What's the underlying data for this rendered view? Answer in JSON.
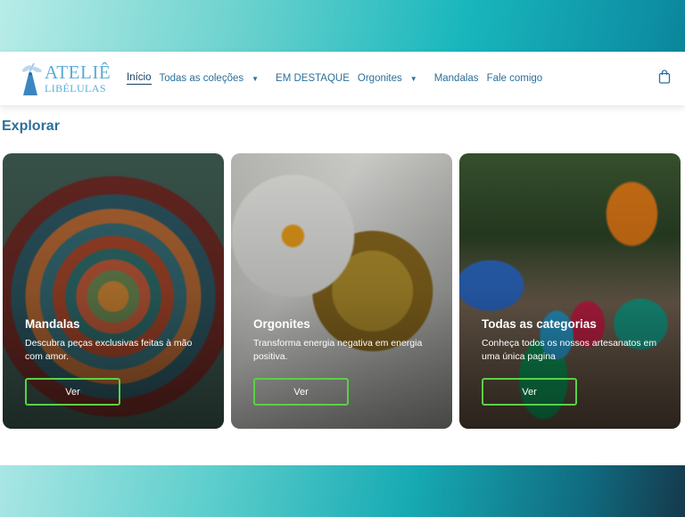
{
  "brand": {
    "logo_line1": "ATELIÊ",
    "logo_line2": "LIBÉLULAS",
    "accent_color": "#5aaed8"
  },
  "nav": {
    "items": [
      {
        "label": "Início",
        "active": true,
        "has_dropdown": false
      },
      {
        "label": "Todas as coleções",
        "active": false,
        "has_dropdown": true
      },
      {
        "label": "EM DESTAQUE",
        "active": false,
        "has_dropdown": false
      },
      {
        "label": "Orgonites",
        "active": false,
        "has_dropdown": true
      },
      {
        "label": "Mandalas",
        "active": false,
        "has_dropdown": false
      },
      {
        "label": "Fale comigo",
        "active": false,
        "has_dropdown": false
      }
    ],
    "cart_icon": "shopping-bag-icon"
  },
  "section": {
    "title": "Explorar"
  },
  "cards": [
    {
      "title": "Mandalas",
      "description": "Descubra peças exclusivas feitas à mão com amor.",
      "button_label": "Ver"
    },
    {
      "title": "Orgonites",
      "description": "Transforma energia negativa em energia positiva.",
      "button_label": "Ver"
    },
    {
      "title": "Todas as categorias",
      "description": "Conheça todos os nossos artesanatos em uma única pagina",
      "button_label": "Ver"
    }
  ],
  "colors": {
    "nav_text": "#2d6f9a",
    "button_border": "#5ad145"
  }
}
